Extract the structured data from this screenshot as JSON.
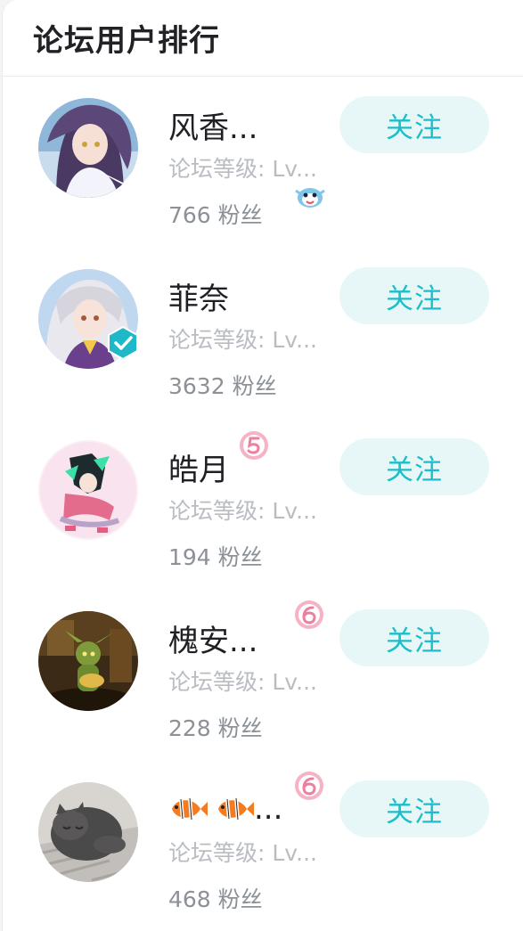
{
  "panel": {
    "title": "论坛用户排行"
  },
  "users": [
    {
      "name": "风香...",
      "level": "论坛等级: Lv...",
      "fans_count": "766",
      "fans_suffix": "粉丝",
      "follow_label": "关注"
    },
    {
      "name": "菲奈",
      "level": "论坛等级: Lv...",
      "fans_count": "3632",
      "fans_suffix": "粉丝",
      "follow_label": "关注"
    },
    {
      "name": "皓月",
      "level": "论坛等级: Lv...",
      "fans_count": "194",
      "fans_suffix": "粉丝",
      "follow_label": "关注"
    },
    {
      "name": "槐安...",
      "level": "论坛等级: Lv...",
      "fans_count": "228",
      "fans_suffix": "粉丝",
      "follow_label": "关注"
    },
    {
      "name": "...",
      "level": "论坛等级: Lv...",
      "fans_count": "468",
      "fans_suffix": "粉丝",
      "follow_label": "关注"
    }
  ],
  "colors": {
    "accent": "#1bbec9",
    "follow_bg": "#e7f7f8",
    "level_badge_pink": "#f08ca6"
  }
}
